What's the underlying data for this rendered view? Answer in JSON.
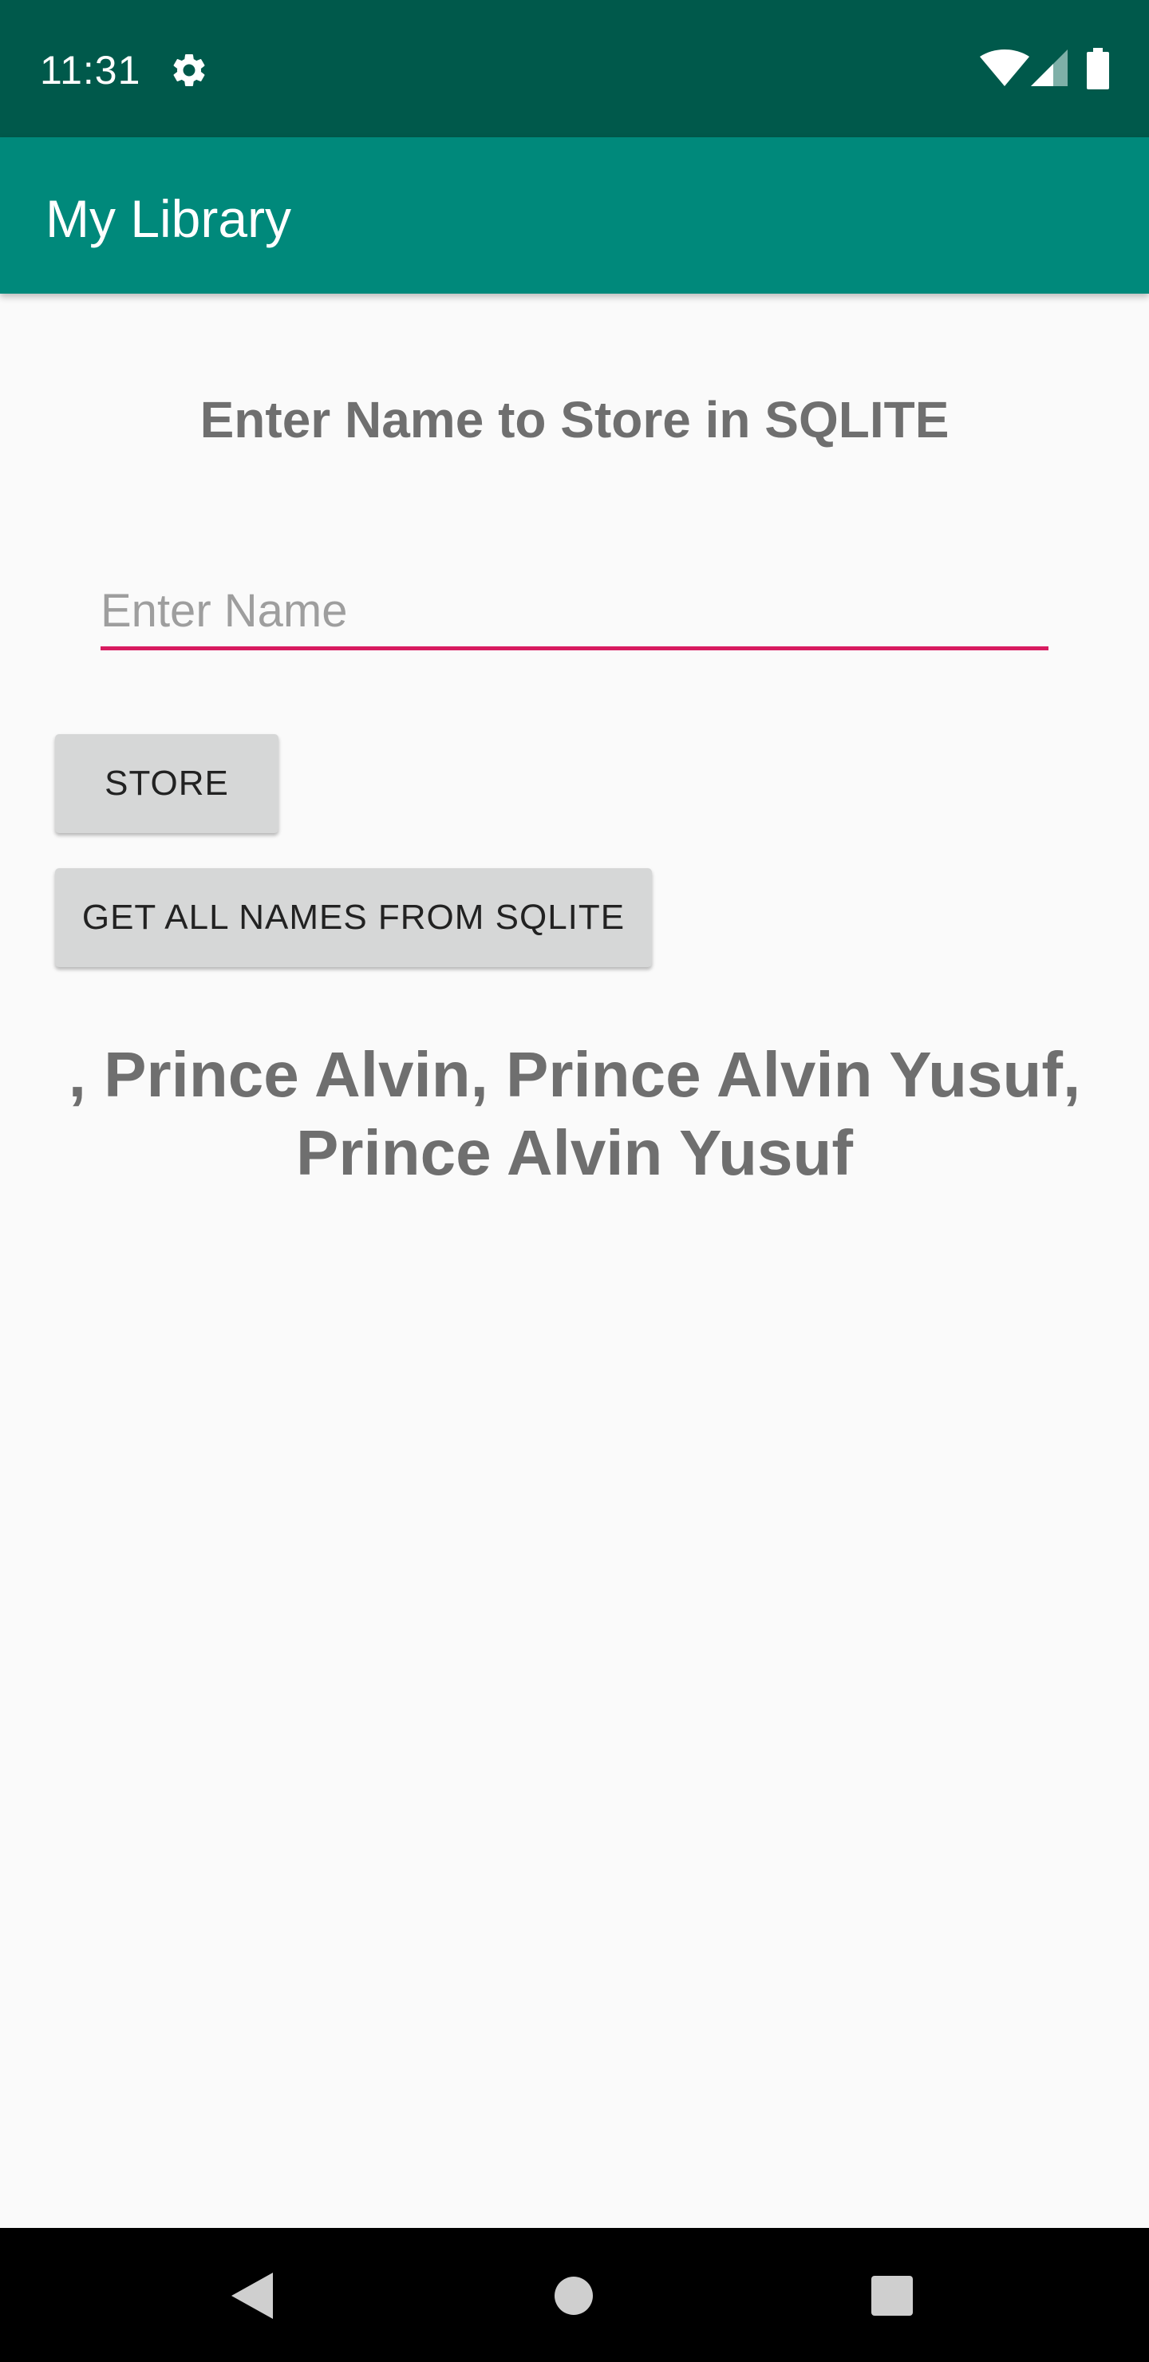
{
  "status_bar": {
    "time": "11:31",
    "icons": [
      "settings-icon",
      "wifi-icon",
      "signal-icon",
      "battery-icon"
    ]
  },
  "app_bar": {
    "title": "My Library"
  },
  "main": {
    "heading": "Enter Name to Store in SQLITE",
    "name_input": {
      "placeholder": "Enter Name",
      "value": ""
    },
    "store_button_label": "STORE",
    "get_all_button_label": "GET ALL NAMES FROM SQLITE",
    "result_text": ", Prince Alvin, Prince Alvin Yusuf, Prince Alvin Yusuf"
  },
  "navigation_bar": {
    "icons": [
      "back-icon",
      "home-icon",
      "recents-icon"
    ]
  },
  "colors": {
    "status_bar": "#00594b",
    "app_bar": "#00897b",
    "accent": "#d81b60",
    "button": "#d6d7d7",
    "text_gray": "#6f6f6f",
    "background": "#fafafa"
  }
}
